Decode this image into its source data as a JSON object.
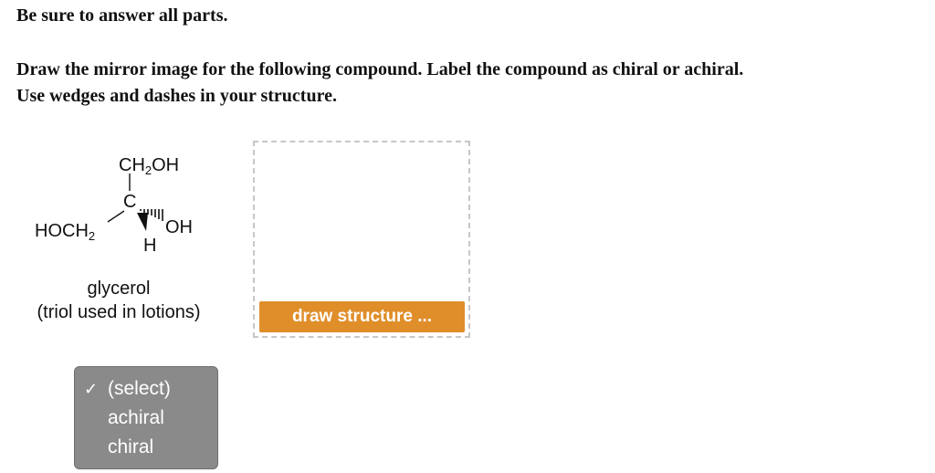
{
  "header": {
    "instruction": "Be sure to answer all parts."
  },
  "question": {
    "line1": "Draw the mirror image for the following compound. Label the compound as chiral or achiral.",
    "line2": "Use wedges and dashes in your structure."
  },
  "molecule": {
    "top_group": "CH",
    "top_sub": "2",
    "top_tail": "OH",
    "center_atom": "C",
    "left_group": "HOCH",
    "left_sub": "2",
    "right_group": "OH",
    "bottom_group": "H",
    "name": "glycerol",
    "description": "(triol used in lotions)"
  },
  "draw_area": {
    "button_label": "draw structure ..."
  },
  "select": {
    "options": [
      {
        "label": "(select)",
        "checked": true
      },
      {
        "label": "achiral",
        "checked": false
      },
      {
        "label": "chiral",
        "checked": false
      }
    ],
    "check_mark": "✓"
  },
  "colors": {
    "button_bg": "#e08e2a",
    "dropdown_bg": "#8a8a8a",
    "dashed_border": "#c7c7c7"
  }
}
